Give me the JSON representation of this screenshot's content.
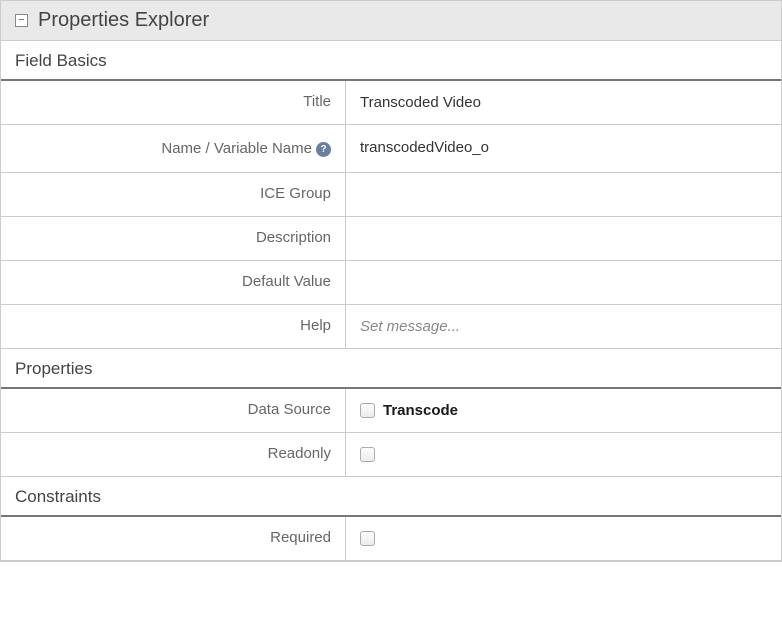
{
  "panel": {
    "title": "Properties Explorer"
  },
  "sections": {
    "fieldBasics": {
      "header": "Field Basics",
      "rows": {
        "title": {
          "label": "Title",
          "value": "Transcoded Video"
        },
        "name": {
          "label": "Name / Variable Name",
          "value": "transcodedVideo_o"
        },
        "iceGroup": {
          "label": "ICE Group",
          "value": ""
        },
        "description": {
          "label": "Description",
          "value": ""
        },
        "defaultValue": {
          "label": "Default Value",
          "value": ""
        },
        "help": {
          "label": "Help",
          "placeholder": "Set message..."
        }
      }
    },
    "properties": {
      "header": "Properties",
      "rows": {
        "dataSource": {
          "label": "Data Source",
          "checkboxLabel": "Transcode"
        },
        "readonly": {
          "label": "Readonly"
        }
      }
    },
    "constraints": {
      "header": "Constraints",
      "rows": {
        "required": {
          "label": "Required"
        }
      }
    }
  }
}
